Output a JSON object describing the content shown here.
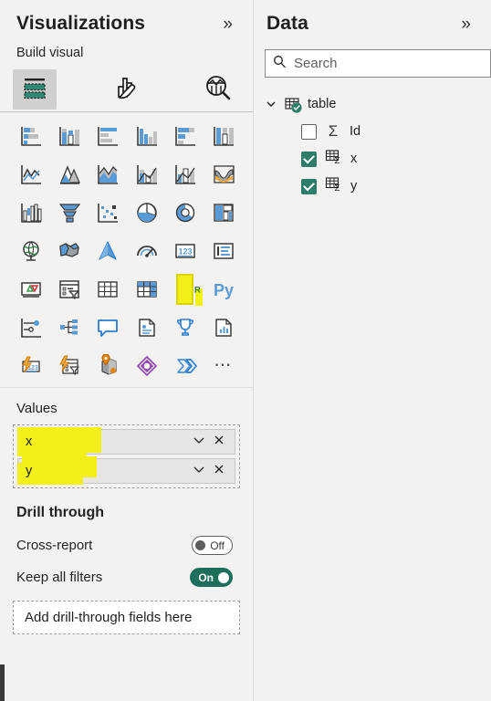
{
  "visualizations": {
    "title": "Visualizations",
    "collapse_icon": "chevron-double-right-icon",
    "build_visual_label": "Build visual",
    "tabs": [
      {
        "name": "build-visual",
        "icon": "fields-wells-icon",
        "selected": true
      },
      {
        "name": "format-visual",
        "icon": "paintbrush-icon",
        "selected": false
      },
      {
        "name": "analytics",
        "icon": "magnifier-chart-icon",
        "selected": false
      }
    ],
    "gallery": [
      {
        "name": "stacked-bar-chart",
        "icon": "stacked-bar-chart-icon"
      },
      {
        "name": "stacked-column-chart",
        "icon": "stacked-column-chart-icon"
      },
      {
        "name": "clustered-bar-chart",
        "icon": "clustered-bar-chart-icon"
      },
      {
        "name": "clustered-column-chart",
        "icon": "clustered-column-chart-icon"
      },
      {
        "name": "100-stacked-bar-chart",
        "icon": "hundred-stacked-bar-icon"
      },
      {
        "name": "100-stacked-column-chart",
        "icon": "hundred-stacked-column-icon"
      },
      {
        "name": "line-chart",
        "icon": "line-chart-icon"
      },
      {
        "name": "area-chart",
        "icon": "area-chart-icon"
      },
      {
        "name": "stacked-area-chart",
        "icon": "stacked-area-chart-icon"
      },
      {
        "name": "line-and-stacked-column-chart",
        "icon": "line-stacked-column-icon"
      },
      {
        "name": "line-and-clustered-column-chart",
        "icon": "line-clustered-column-icon"
      },
      {
        "name": "ribbon-chart",
        "icon": "ribbon-chart-icon"
      },
      {
        "name": "waterfall-chart",
        "icon": "waterfall-chart-icon"
      },
      {
        "name": "funnel-chart",
        "icon": "funnel-chart-icon"
      },
      {
        "name": "scatter-chart",
        "icon": "scatter-chart-icon"
      },
      {
        "name": "pie-chart",
        "icon": "pie-chart-icon"
      },
      {
        "name": "donut-chart",
        "icon": "donut-chart-icon"
      },
      {
        "name": "treemap",
        "icon": "treemap-icon"
      },
      {
        "name": "map",
        "icon": "globe-map-icon"
      },
      {
        "name": "filled-map",
        "icon": "filled-map-icon"
      },
      {
        "name": "azure-map",
        "icon": "azure-map-arrow-icon"
      },
      {
        "name": "gauge",
        "icon": "gauge-icon"
      },
      {
        "name": "card",
        "icon": "card-123-icon"
      },
      {
        "name": "multi-row-card",
        "icon": "multi-row-card-icon"
      },
      {
        "name": "kpi",
        "icon": "kpi-updown-icon"
      },
      {
        "name": "slicer",
        "icon": "slicer-filter-icon"
      },
      {
        "name": "table",
        "icon": "table-grid-icon"
      },
      {
        "name": "matrix",
        "icon": "matrix-grid-icon"
      },
      {
        "name": "r-script-visual",
        "icon": "r-script-icon",
        "highlighted": true
      },
      {
        "name": "python-visual",
        "icon": "py-script-icon"
      },
      {
        "name": "key-influencers",
        "icon": "key-influencers-icon"
      },
      {
        "name": "decomposition-tree",
        "icon": "decomposition-tree-icon"
      },
      {
        "name": "qa-visual",
        "icon": "qa-speech-bubble-icon"
      },
      {
        "name": "smart-narrative",
        "icon": "smart-narrative-icon"
      },
      {
        "name": "metrics",
        "icon": "trophy-metrics-icon"
      },
      {
        "name": "paginated-report",
        "icon": "paginated-report-icon"
      },
      {
        "name": "power-automate-card",
        "icon": "power-automate-card-icon"
      },
      {
        "name": "power-automate-slicer",
        "icon": "power-automate-slicer-icon"
      },
      {
        "name": "arcgis-map",
        "icon": "arcgis-map-icon"
      },
      {
        "name": "power-apps",
        "icon": "power-apps-icon"
      },
      {
        "name": "power-automate",
        "icon": "power-automate-icon"
      },
      {
        "name": "more-options",
        "icon": "ellipsis-icon"
      }
    ],
    "values": {
      "section_title": "Values",
      "fields": [
        {
          "label": "x",
          "highlighted": true,
          "dropdown_icon": "chevron-down-icon",
          "remove_icon": "close-icon"
        },
        {
          "label": "y",
          "highlighted": true,
          "dropdown_icon": "chevron-down-icon",
          "remove_icon": "close-icon"
        }
      ]
    },
    "drill_through": {
      "section_title": "Drill through",
      "rows": [
        {
          "label": "Cross-report",
          "state": "Off",
          "on": false
        },
        {
          "label": "Keep all filters",
          "state": "On",
          "on": true
        }
      ],
      "dropzone_label": "Add drill-through fields here"
    }
  },
  "data": {
    "title": "Data",
    "collapse_icon": "chevron-double-right-icon",
    "search": {
      "placeholder": "Search",
      "value": "",
      "icon": "search-icon"
    },
    "tree": {
      "table": {
        "label": "table",
        "expanded": true,
        "icon": "table-icon",
        "expand_icon": "chevron-down-icon"
      },
      "fields": [
        {
          "label": "Id",
          "checked": false,
          "icon": "sigma-icon"
        },
        {
          "label": "x",
          "checked": true,
          "icon": "measure-table-icon"
        },
        {
          "label": "y",
          "checked": true,
          "icon": "measure-table-icon"
        }
      ]
    }
  },
  "colors": {
    "accent_teal": "#2e7d68",
    "highlight_yellow": "#f2ef19",
    "chart_blue": "#5b9bd5",
    "panel_bg": "#f3f2f1"
  }
}
